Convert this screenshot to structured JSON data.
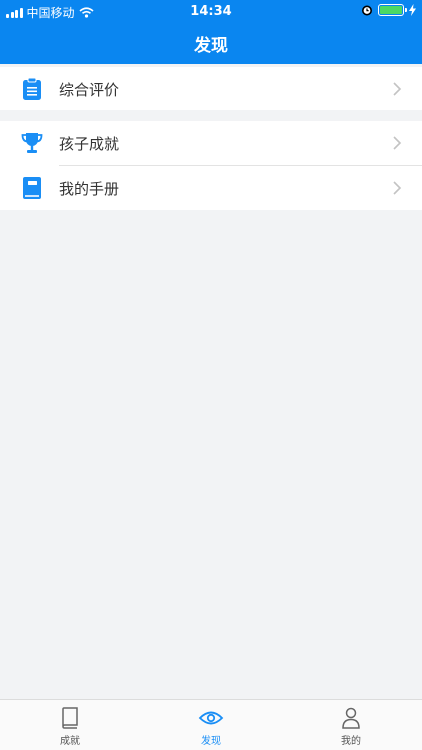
{
  "status_bar": {
    "carrier": "中国移动",
    "time": "14:34"
  },
  "header": {
    "title": "发现"
  },
  "menu": {
    "items": [
      {
        "label": "综合评价",
        "icon": "clipboard-icon"
      },
      {
        "label": "孩子成就",
        "icon": "trophy-icon"
      },
      {
        "label": "我的手册",
        "icon": "book-icon"
      }
    ]
  },
  "tabbar": {
    "tabs": [
      {
        "label": "成就",
        "icon": "book-outline-icon"
      },
      {
        "label": "发现",
        "icon": "eye-icon",
        "active": true
      },
      {
        "label": "我的",
        "icon": "person-icon"
      }
    ]
  },
  "colors": {
    "brand": "#0a86f0",
    "active_tab": "#1a8ef5",
    "icon_blue": "#1a8ef5"
  }
}
